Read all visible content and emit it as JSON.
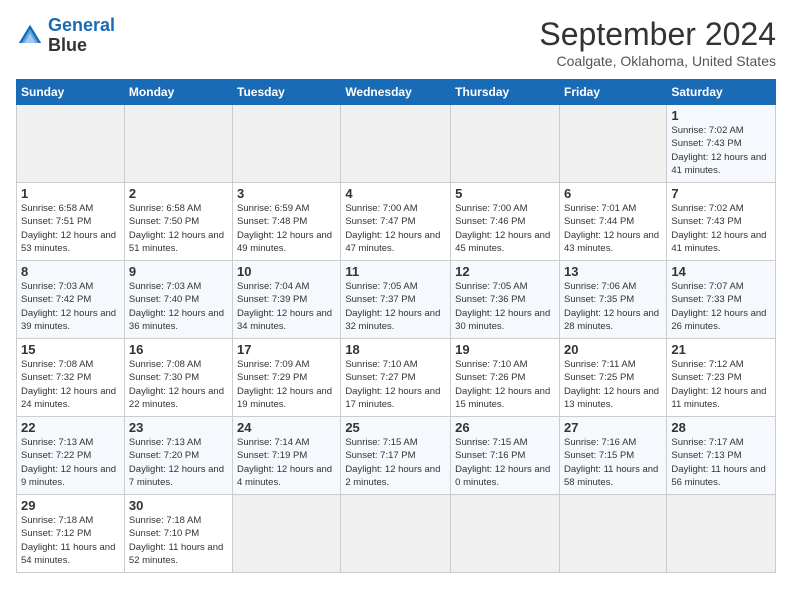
{
  "header": {
    "logo_line1": "General",
    "logo_line2": "Blue",
    "month_title": "September 2024",
    "location": "Coalgate, Oklahoma, United States"
  },
  "calendar": {
    "headers": [
      "Sunday",
      "Monday",
      "Tuesday",
      "Wednesday",
      "Thursday",
      "Friday",
      "Saturday"
    ],
    "weeks": [
      [
        {
          "day": "",
          "empty": true
        },
        {
          "day": "",
          "empty": true
        },
        {
          "day": "",
          "empty": true
        },
        {
          "day": "",
          "empty": true
        },
        {
          "day": "",
          "empty": true
        },
        {
          "day": "",
          "empty": true
        },
        {
          "day": "1",
          "sunrise": "Sunrise: 7:02 AM",
          "sunset": "Sunset: 7:43 PM",
          "daylight": "Daylight: 12 hours and 41 minutes."
        }
      ],
      [
        {
          "day": "1",
          "sunrise": "Sunrise: 6:58 AM",
          "sunset": "Sunset: 7:51 PM",
          "daylight": "Daylight: 12 hours and 53 minutes."
        },
        {
          "day": "2",
          "sunrise": "Sunrise: 6:58 AM",
          "sunset": "Sunset: 7:50 PM",
          "daylight": "Daylight: 12 hours and 51 minutes."
        },
        {
          "day": "3",
          "sunrise": "Sunrise: 6:59 AM",
          "sunset": "Sunset: 7:48 PM",
          "daylight": "Daylight: 12 hours and 49 minutes."
        },
        {
          "day": "4",
          "sunrise": "Sunrise: 7:00 AM",
          "sunset": "Sunset: 7:47 PM",
          "daylight": "Daylight: 12 hours and 47 minutes."
        },
        {
          "day": "5",
          "sunrise": "Sunrise: 7:00 AM",
          "sunset": "Sunset: 7:46 PM",
          "daylight": "Daylight: 12 hours and 45 minutes."
        },
        {
          "day": "6",
          "sunrise": "Sunrise: 7:01 AM",
          "sunset": "Sunset: 7:44 PM",
          "daylight": "Daylight: 12 hours and 43 minutes."
        },
        {
          "day": "7",
          "sunrise": "Sunrise: 7:02 AM",
          "sunset": "Sunset: 7:43 PM",
          "daylight": "Daylight: 12 hours and 41 minutes."
        }
      ],
      [
        {
          "day": "8",
          "sunrise": "Sunrise: 7:03 AM",
          "sunset": "Sunset: 7:42 PM",
          "daylight": "Daylight: 12 hours and 39 minutes."
        },
        {
          "day": "9",
          "sunrise": "Sunrise: 7:03 AM",
          "sunset": "Sunset: 7:40 PM",
          "daylight": "Daylight: 12 hours and 36 minutes."
        },
        {
          "day": "10",
          "sunrise": "Sunrise: 7:04 AM",
          "sunset": "Sunset: 7:39 PM",
          "daylight": "Daylight: 12 hours and 34 minutes."
        },
        {
          "day": "11",
          "sunrise": "Sunrise: 7:05 AM",
          "sunset": "Sunset: 7:37 PM",
          "daylight": "Daylight: 12 hours and 32 minutes."
        },
        {
          "day": "12",
          "sunrise": "Sunrise: 7:05 AM",
          "sunset": "Sunset: 7:36 PM",
          "daylight": "Daylight: 12 hours and 30 minutes."
        },
        {
          "day": "13",
          "sunrise": "Sunrise: 7:06 AM",
          "sunset": "Sunset: 7:35 PM",
          "daylight": "Daylight: 12 hours and 28 minutes."
        },
        {
          "day": "14",
          "sunrise": "Sunrise: 7:07 AM",
          "sunset": "Sunset: 7:33 PM",
          "daylight": "Daylight: 12 hours and 26 minutes."
        }
      ],
      [
        {
          "day": "15",
          "sunrise": "Sunrise: 7:08 AM",
          "sunset": "Sunset: 7:32 PM",
          "daylight": "Daylight: 12 hours and 24 minutes."
        },
        {
          "day": "16",
          "sunrise": "Sunrise: 7:08 AM",
          "sunset": "Sunset: 7:30 PM",
          "daylight": "Daylight: 12 hours and 22 minutes."
        },
        {
          "day": "17",
          "sunrise": "Sunrise: 7:09 AM",
          "sunset": "Sunset: 7:29 PM",
          "daylight": "Daylight: 12 hours and 19 minutes."
        },
        {
          "day": "18",
          "sunrise": "Sunrise: 7:10 AM",
          "sunset": "Sunset: 7:27 PM",
          "daylight": "Daylight: 12 hours and 17 minutes."
        },
        {
          "day": "19",
          "sunrise": "Sunrise: 7:10 AM",
          "sunset": "Sunset: 7:26 PM",
          "daylight": "Daylight: 12 hours and 15 minutes."
        },
        {
          "day": "20",
          "sunrise": "Sunrise: 7:11 AM",
          "sunset": "Sunset: 7:25 PM",
          "daylight": "Daylight: 12 hours and 13 minutes."
        },
        {
          "day": "21",
          "sunrise": "Sunrise: 7:12 AM",
          "sunset": "Sunset: 7:23 PM",
          "daylight": "Daylight: 12 hours and 11 minutes."
        }
      ],
      [
        {
          "day": "22",
          "sunrise": "Sunrise: 7:13 AM",
          "sunset": "Sunset: 7:22 PM",
          "daylight": "Daylight: 12 hours and 9 minutes."
        },
        {
          "day": "23",
          "sunrise": "Sunrise: 7:13 AM",
          "sunset": "Sunset: 7:20 PM",
          "daylight": "Daylight: 12 hours and 7 minutes."
        },
        {
          "day": "24",
          "sunrise": "Sunrise: 7:14 AM",
          "sunset": "Sunset: 7:19 PM",
          "daylight": "Daylight: 12 hours and 4 minutes."
        },
        {
          "day": "25",
          "sunrise": "Sunrise: 7:15 AM",
          "sunset": "Sunset: 7:17 PM",
          "daylight": "Daylight: 12 hours and 2 minutes."
        },
        {
          "day": "26",
          "sunrise": "Sunrise: 7:15 AM",
          "sunset": "Sunset: 7:16 PM",
          "daylight": "Daylight: 12 hours and 0 minutes."
        },
        {
          "day": "27",
          "sunrise": "Sunrise: 7:16 AM",
          "sunset": "Sunset: 7:15 PM",
          "daylight": "Daylight: 11 hours and 58 minutes."
        },
        {
          "day": "28",
          "sunrise": "Sunrise: 7:17 AM",
          "sunset": "Sunset: 7:13 PM",
          "daylight": "Daylight: 11 hours and 56 minutes."
        }
      ],
      [
        {
          "day": "29",
          "sunrise": "Sunrise: 7:18 AM",
          "sunset": "Sunset: 7:12 PM",
          "daylight": "Daylight: 11 hours and 54 minutes."
        },
        {
          "day": "30",
          "sunrise": "Sunrise: 7:18 AM",
          "sunset": "Sunset: 7:10 PM",
          "daylight": "Daylight: 11 hours and 52 minutes."
        },
        {
          "day": "",
          "empty": true
        },
        {
          "day": "",
          "empty": true
        },
        {
          "day": "",
          "empty": true
        },
        {
          "day": "",
          "empty": true
        },
        {
          "day": "",
          "empty": true
        }
      ]
    ]
  }
}
